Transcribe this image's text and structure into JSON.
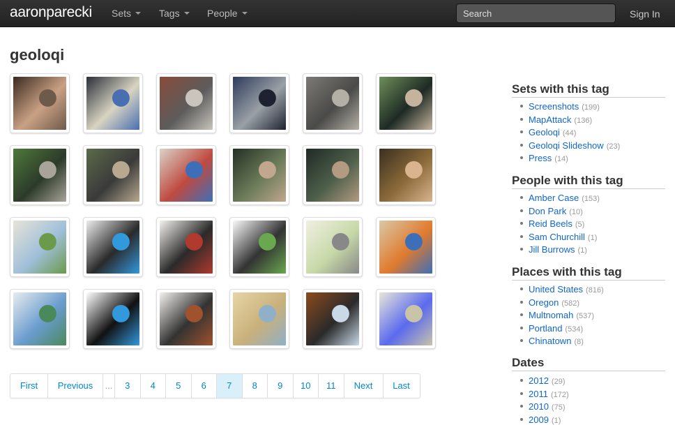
{
  "nav": {
    "brand": "aaronparecki",
    "items": [
      {
        "label": "Sets"
      },
      {
        "label": "Tags"
      },
      {
        "label": "People"
      }
    ],
    "search_placeholder": "Search",
    "sign_in": "Sign In"
  },
  "page_title": "geoloqi",
  "thumbnails": [
    {
      "subject": "two people at a laptop",
      "colors": [
        "#3b2a20",
        "#c9a184",
        "#6e5a4a"
      ]
    },
    {
      "subject": "tablet showing map",
      "colors": [
        "#2a2f3a",
        "#d9d4c2",
        "#4a6fb0"
      ]
    },
    {
      "subject": "brick building street",
      "colors": [
        "#8a4b3a",
        "#5c5c5c",
        "#c9c4bc"
      ]
    },
    {
      "subject": "cyclist with helmet",
      "colors": [
        "#2d3b5c",
        "#9aa0a6",
        "#1e2230"
      ]
    },
    {
      "subject": "pedestrians crossing street",
      "colors": [
        "#7d7a76",
        "#4a4a48",
        "#b5b0a6"
      ]
    },
    {
      "subject": "phone held in hand",
      "colors": [
        "#6f8f5a",
        "#1d2a24",
        "#c6b39e"
      ]
    },
    {
      "subject": "cyclists in park",
      "colors": [
        "#4e7a3a",
        "#2c3a2a",
        "#a9a49a"
      ]
    },
    {
      "subject": "cyclists on path",
      "colors": [
        "#5c6a4a",
        "#3a3a3a",
        "#b7a88f"
      ]
    },
    {
      "subject": "phone map game",
      "colors": [
        "#d8d3c8",
        "#c04a40",
        "#3d6fb8"
      ]
    },
    {
      "subject": "men in trees",
      "colors": [
        "#243024",
        "#6b7b5a",
        "#c1a78d"
      ]
    },
    {
      "subject": "men in dark jackets",
      "colors": [
        "#1f2a26",
        "#4e5f4a",
        "#b39a82"
      ]
    },
    {
      "subject": "smiling man outdoors",
      "colors": [
        "#3a2f1f",
        "#8c6b3a",
        "#d9b48f"
      ]
    },
    {
      "subject": "street map",
      "colors": [
        "#e8e4d8",
        "#9fbfd9",
        "#6b9a4a"
      ]
    },
    {
      "subject": "phone layer permission",
      "colors": [
        "#ececec",
        "#2a2a2a",
        "#3399dd"
      ]
    },
    {
      "subject": "oregonian news page",
      "colors": [
        "#f4f2ee",
        "#2a2a2a",
        "#b03a2e"
      ]
    },
    {
      "subject": "app layer list",
      "colors": [
        "#fafafa",
        "#333333",
        "#6aa84f"
      ]
    },
    {
      "subject": "news article map",
      "colors": [
        "#f1efe2",
        "#c7d9a8",
        "#888888"
      ]
    },
    {
      "subject": "seattle events map",
      "colors": [
        "#d9c9a8",
        "#e07a2e",
        "#3d6fb8"
      ]
    },
    {
      "subject": "transit map",
      "colors": [
        "#e8ecef",
        "#6a9ccf",
        "#4a8a5a"
      ]
    },
    {
      "subject": "geoloqi connect screen",
      "colors": [
        "#ffffff",
        "#111111",
        "#3399dd"
      ]
    },
    {
      "subject": "newspaper page",
      "colors": [
        "#f4f2ee",
        "#333333",
        "#a0522d"
      ]
    },
    {
      "subject": "world map",
      "colors": [
        "#e6d6a6",
        "#c9b07a",
        "#8fb0c8"
      ]
    },
    {
      "subject": "hand holding phone map",
      "colors": [
        "#8c4a1e",
        "#2a2a2a",
        "#c9d9e8"
      ]
    },
    {
      "subject": "map with blue circles",
      "colors": [
        "#e8e6d8",
        "#5a6aee",
        "#c9c4a8"
      ]
    }
  ],
  "pagination": [
    "First",
    "Previous",
    "...",
    "3",
    "4",
    "5",
    "6",
    "7",
    "8",
    "9",
    "10",
    "11",
    "Next",
    "Last"
  ],
  "pagination_active": "7",
  "sidebar": {
    "sets": {
      "heading": "Sets with this tag",
      "items": [
        {
          "label": "Screenshots",
          "count": "(199)"
        },
        {
          "label": "MapAttack",
          "count": "(136)"
        },
        {
          "label": "Geoloqi",
          "count": "(44)"
        },
        {
          "label": "Geoloqi Slideshow",
          "count": "(23)"
        },
        {
          "label": "Press",
          "count": "(14)"
        }
      ]
    },
    "people": {
      "heading": "People with this tag",
      "items": [
        {
          "label": "Amber Case",
          "count": "(153)"
        },
        {
          "label": "Don Park",
          "count": "(10)"
        },
        {
          "label": "Reid Beels",
          "count": "(5)"
        },
        {
          "label": "Sam Churchill",
          "count": "(1)"
        },
        {
          "label": "Jill Burrows",
          "count": "(1)"
        }
      ]
    },
    "places": {
      "heading": "Places with this tag",
      "items": [
        {
          "label": "United States",
          "count": "(816)"
        },
        {
          "label": "Oregon",
          "count": "(582)"
        },
        {
          "label": "Multnomah",
          "count": "(537)"
        },
        {
          "label": "Portland",
          "count": "(534)"
        },
        {
          "label": "Chinatown",
          "count": "(8)"
        }
      ]
    },
    "dates": {
      "heading": "Dates",
      "items": [
        {
          "label": "2012",
          "count": "(29)"
        },
        {
          "label": "2011",
          "count": "(172)"
        },
        {
          "label": "2010",
          "count": "(75)"
        },
        {
          "label": "2009",
          "count": "(1)"
        }
      ]
    }
  }
}
